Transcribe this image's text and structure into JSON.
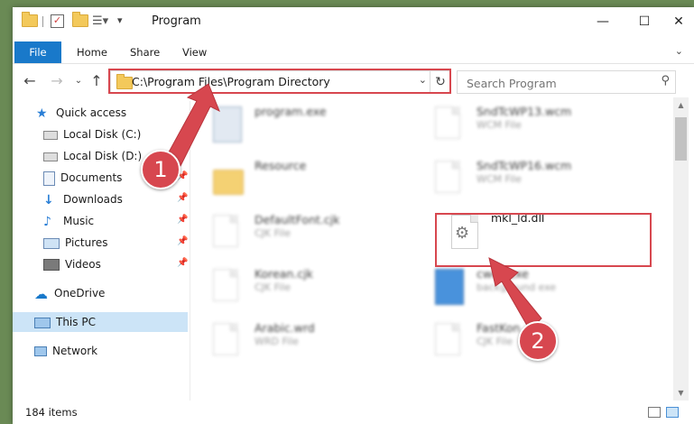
{
  "window": {
    "title": "Program"
  },
  "ribbon": {
    "tabs": [
      "File",
      "Home",
      "Share",
      "View"
    ]
  },
  "address": {
    "path": "C:\\Program Files\\Program Directory"
  },
  "search": {
    "placeholder": "Search Program"
  },
  "sidebar": {
    "quick_access": "Quick access",
    "items": [
      "Local Disk (C:)",
      "Local Disk (D:)",
      "Documents",
      "Downloads",
      "Music",
      "Pictures",
      "Videos"
    ],
    "onedrive": "OneDrive",
    "thispc": "This PC",
    "network": "Network"
  },
  "files": [
    {
      "name": "program.exe",
      "sub": ""
    },
    {
      "name": "SndTcWP13.wcm",
      "sub": "WCM File"
    },
    {
      "name": "Resource",
      "sub": ""
    },
    {
      "name": "SndTcWP16.wcm",
      "sub": "WCM File"
    },
    {
      "name": "DefaultFont.cjk",
      "sub": "CJK File"
    },
    {
      "name": "mkl_ld.dll",
      "sub": ""
    },
    {
      "name": "Korean.cjk",
      "sub": "CJK File"
    },
    {
      "name": "cwec.exe",
      "sub": "background exe"
    },
    {
      "name": "Arabic.wrd",
      "sub": "WRD File"
    },
    {
      "name": "FastKon",
      "sub": "CJK File"
    }
  ],
  "status": {
    "count": "184 items"
  },
  "callouts": [
    "1",
    "2"
  ],
  "colors": {
    "accent": "#1979ca",
    "highlight": "#d7474f"
  }
}
